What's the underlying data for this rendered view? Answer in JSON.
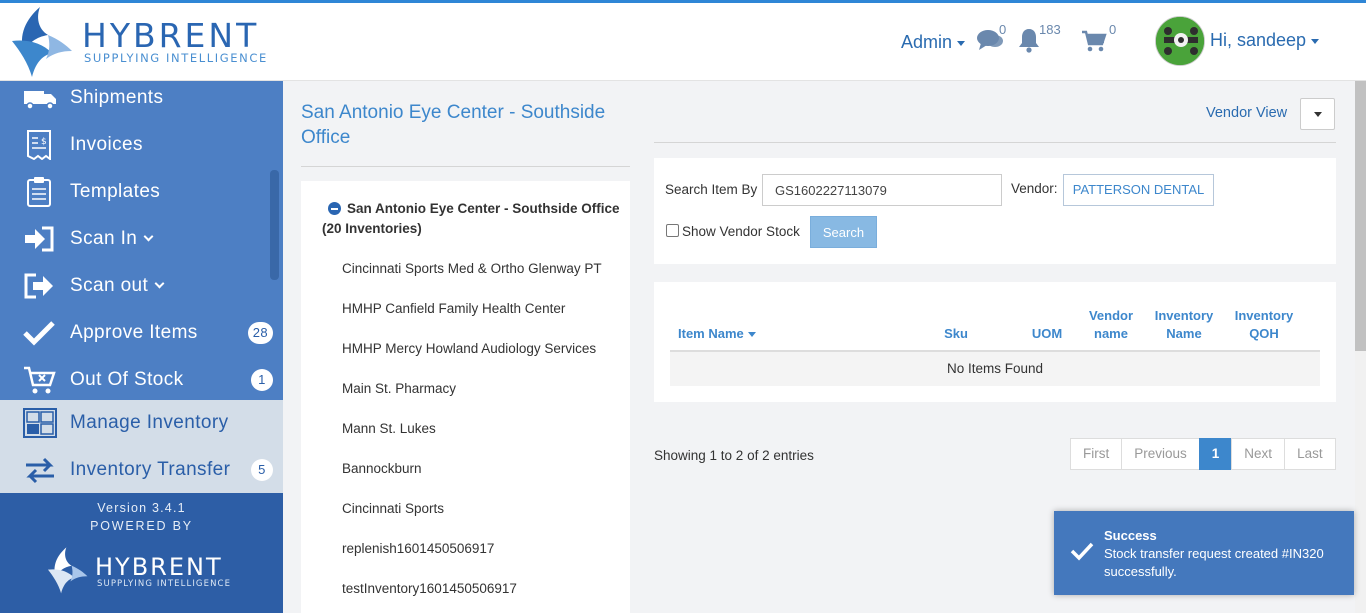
{
  "header": {
    "brand": "HYBRENT",
    "tagline": "SUPPLYING INTELLIGENCE",
    "admin_label": "Admin",
    "messages_count": "0",
    "notifications_count": "183",
    "cart_count": "0",
    "greeting": "Hi, sandeep"
  },
  "sidebar": {
    "items": [
      {
        "label": "Shipments",
        "icon": "truck-icon"
      },
      {
        "label": "Invoices",
        "icon": "invoice-icon"
      },
      {
        "label": "Templates",
        "icon": "clipboard-icon"
      },
      {
        "label": "Scan In",
        "icon": "sign-in-icon"
      },
      {
        "label": "Scan out",
        "icon": "sign-out-icon"
      },
      {
        "label": "Approve Items",
        "icon": "check-icon",
        "badge": "28"
      },
      {
        "label": "Out Of Stock",
        "icon": "cart-icon",
        "badge": "1"
      },
      {
        "label": "Manage Inventory",
        "icon": "inventory-icon"
      },
      {
        "label": "Inventory Transfer",
        "icon": "transfer-icon",
        "badge": "5"
      }
    ],
    "version": "Version 3.4.1",
    "powered_by": "POWERED BY",
    "footer_brand": "HYBRENT",
    "footer_tagline": "SUPPLYING INTELLIGENCE"
  },
  "location": {
    "title": "San Antonio Eye Center - Southside Office",
    "root": "San Antonio Eye Center - Southside Office (20 Inventories)",
    "inventories": [
      "Cincinnati Sports Med & Ortho Glenway PT",
      "HMHP Canfield Family Health Center",
      "HMHP Mercy Howland Audiology Services",
      "Main St. Pharmacy",
      "Mann St. Lukes",
      "Bannockburn",
      "Cincinnati Sports",
      "replenish1601450506917",
      "testInventory1601450506917"
    ]
  },
  "search": {
    "vendor_view": "Vendor View",
    "search_label": "Search Item By",
    "search_value": "GS1602227113079",
    "vendor_label": "Vendor:",
    "vendor_value": "PATTERSON DENTAL",
    "show_vendor_stock": "Show Vendor Stock",
    "search_button": "Search"
  },
  "table": {
    "columns": [
      "Item Name",
      "Sku",
      "UOM",
      "Vendor name",
      "Inventory Name",
      "Inventory QOH"
    ],
    "empty": "No Items Found"
  },
  "pagination": {
    "showing": "Showing 1 to 2 of 2 entries",
    "first": "First",
    "previous": "Previous",
    "current": "1",
    "next": "Next",
    "last": "Last"
  },
  "toast": {
    "title": "Success",
    "message": "Stock transfer request created #IN320 successfully."
  },
  "colors": {
    "sidebar": "#4d7fc4",
    "accent": "#3d87cc",
    "toast": "#4478bd"
  }
}
